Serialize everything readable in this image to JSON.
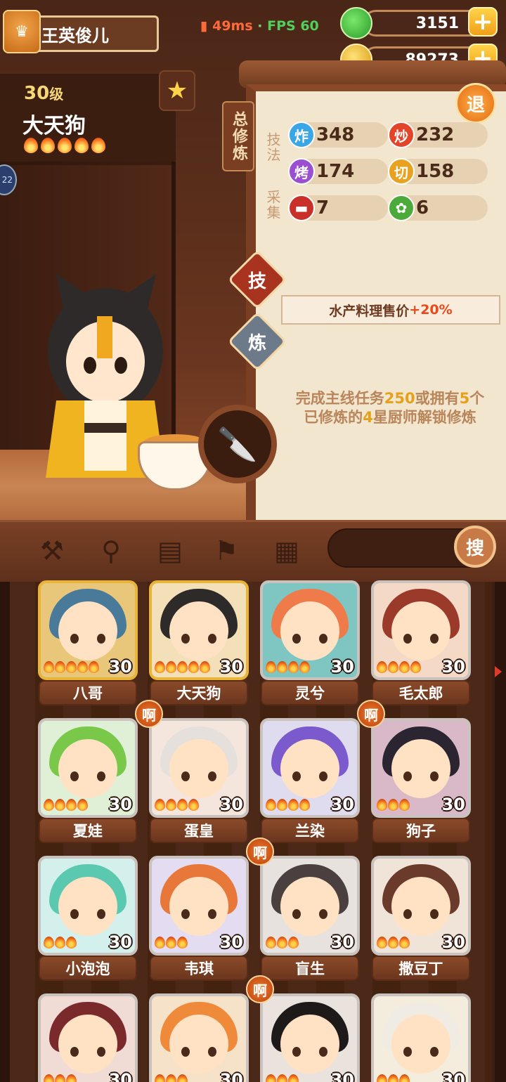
{
  "header": {
    "player_name": "王英俊儿",
    "ping": "49ms",
    "separator": "·",
    "fps": "FPS 60",
    "currencies": [
      {
        "name": "jade",
        "value": "3151",
        "icon": "jade-icon",
        "color": "#3bbf3a"
      },
      {
        "name": "coin",
        "value": "89273",
        "icon": "coin-icon",
        "color": "#f3b21f"
      }
    ],
    "plus": "+"
  },
  "chef": {
    "level": "30",
    "level_unit": "级",
    "name": "大天狗",
    "stars": 5
  },
  "panel": {
    "total_tab": "总修炼",
    "exit": "退",
    "skill_group": "技法",
    "gather_group": "采集",
    "skills": [
      {
        "icon": "炸",
        "value": "348",
        "color": "#3aa6e6"
      },
      {
        "icon": "炒",
        "value": "232",
        "color": "#e2452a"
      },
      {
        "icon": "烤",
        "value": "174",
        "color": "#9b4fd0"
      },
      {
        "icon": "切",
        "value": "158",
        "color": "#e8a21f"
      }
    ],
    "gathers": [
      {
        "icon": "meat-icon",
        "value": "7",
        "color": "#c9302a"
      },
      {
        "icon": "vegetable-icon",
        "value": "6",
        "color": "#4caa3a"
      }
    ],
    "tab_skill": "技",
    "tab_train": "炼",
    "bonus_text": "水产料理售价",
    "bonus_value": "+20%",
    "unlock_line1_a": "完成主线任务",
    "unlock_line1_b": "250",
    "unlock_line1_c": "或拥有",
    "unlock_line1_d": "5",
    "unlock_line1_e": "个",
    "unlock_line2_a": "已修炼的",
    "unlock_line2_b": "4",
    "unlock_line2_c": "星厨师解锁修炼"
  },
  "navbar": {
    "icons": [
      "knife-icon",
      "spatula-icon",
      "jar-icon",
      "location-icon",
      "map-icon"
    ],
    "search": "搜"
  },
  "badge_text": "啊",
  "chefs": [
    {
      "name": "八哥",
      "level": "30",
      "stars": 5,
      "hair": "#4a7a9a",
      "bg": "#e9c77a",
      "selected": true
    },
    {
      "name": "大天狗",
      "level": "30",
      "stars": 5,
      "hair": "#2f2a2a",
      "bg": "#f3e0b8",
      "selected": true
    },
    {
      "name": "灵兮",
      "level": "30",
      "stars": 4,
      "hair": "#ef7a4a",
      "bg": "#7fc6c3",
      "selected": false
    },
    {
      "name": "毛太郎",
      "level": "30",
      "stars": 4,
      "hair": "#9a3a2a",
      "bg": "#f4d9c6",
      "selected": false
    },
    {
      "name": "夏娃",
      "level": "30",
      "stars": 4,
      "hair": "#7ac84a",
      "bg": "#dff0d6",
      "selected": false
    },
    {
      "name": "蛋皇",
      "level": "30",
      "stars": 4,
      "hair": "#e6e0dc",
      "bg": "#f4e6dc",
      "selected": false
    },
    {
      "name": "兰染",
      "level": "30",
      "stars": 4,
      "hair": "#7a5acc",
      "bg": "#e0dcf0",
      "selected": false
    },
    {
      "name": "狗子",
      "level": "30",
      "stars": 3,
      "hair": "#2a2530",
      "bg": "#d9b8c8",
      "selected": false
    },
    {
      "name": "小泡泡",
      "level": "30",
      "stars": 3,
      "hair": "#5ac9b0",
      "bg": "#d4f0ec",
      "selected": false
    },
    {
      "name": "韦琪",
      "level": "30",
      "stars": 3,
      "hair": "#e8773a",
      "bg": "#e4dcf0",
      "selected": false
    },
    {
      "name": "盲生",
      "level": "30",
      "stars": 3,
      "hair": "#4a4040",
      "bg": "#e8e2de",
      "selected": false
    },
    {
      "name": "撒豆丁",
      "level": "30",
      "stars": 3,
      "hair": "#6a3a2a",
      "bg": "#f0e4d8",
      "selected": false
    },
    {
      "name": "",
      "level": "30",
      "stars": 3,
      "hair": "#7a2a2a",
      "bg": "#f0dcd4",
      "selected": false
    },
    {
      "name": "",
      "level": "30",
      "stars": 3,
      "hair": "#ef8a3a",
      "bg": "#f6e2c8",
      "selected": false
    },
    {
      "name": "",
      "level": "30",
      "stars": 3,
      "hair": "#1f1a1a",
      "bg": "#eae2dc",
      "selected": false
    },
    {
      "name": "",
      "level": "30",
      "stars": 3,
      "hair": "#f0ece4",
      "bg": "#f4ecdc",
      "selected": false
    }
  ]
}
